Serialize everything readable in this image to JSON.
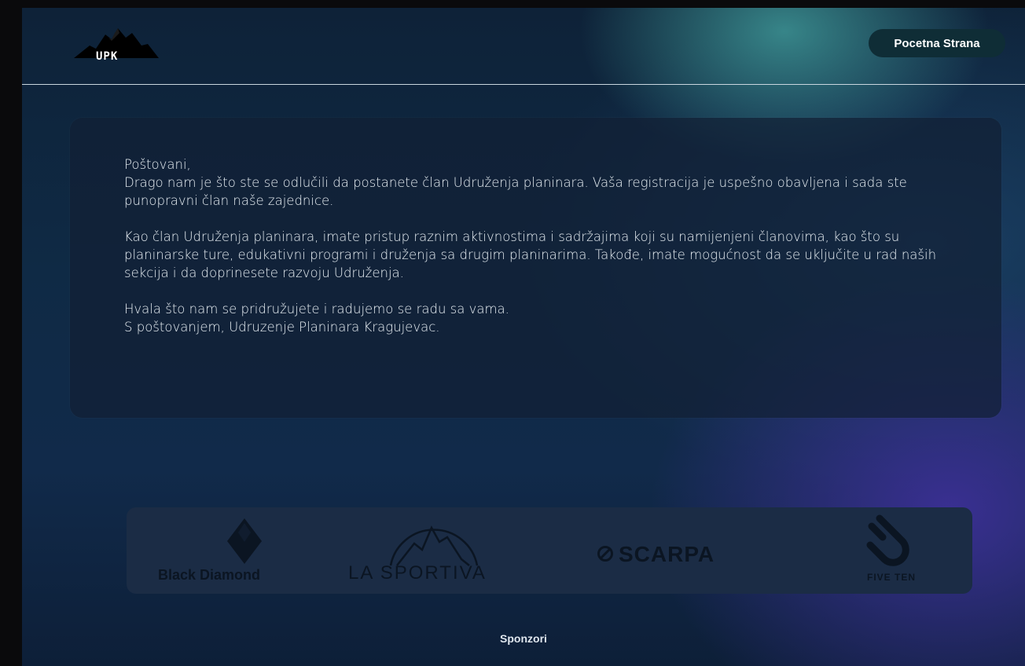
{
  "header": {
    "logo_text": "UPK",
    "nav_button_label": "Pocetna Strana"
  },
  "letter": {
    "greeting": "Poštovani,",
    "paragraph1": "Drago nam je što ste se odlučili da postanete član Udruženja planinara. Vaša registracija je uspešno obavljena i sada ste punopravni član naše zajednice.",
    "paragraph2": "Kao član Udruženja planinara, imate pristup raznim aktivnostima i sadržajima koji su namijenjeni članovima, kao što su planinarske ture, edukativni programi i druženja sa drugim planinarima. Takođe, imate mogućnost da se uključite u rad naših sekcija i da doprinesete razvoju Udruženja.",
    "closing1": "Hvala što nam se pridružujete i radujemo se radu sa vama.",
    "closing2": "S poštovanjem, Udruzenje Planinara Kragujevac."
  },
  "sponsors": {
    "label": "Sponzori",
    "items": [
      {
        "name": "Black Diamond",
        "icon": "black-diamond-logo"
      },
      {
        "name": "LA SPORTIVA",
        "icon": "la-sportiva-logo"
      },
      {
        "name": "SCARPA",
        "icon": "scarpa-logo"
      },
      {
        "name": "FIVE TEN",
        "icon": "five-ten-logo"
      }
    ]
  },
  "colors": {
    "nav_button_bg": "#0f2d36",
    "sponsor_panel_bg": "#1b2c45",
    "logo_ink": "#0b1522"
  }
}
